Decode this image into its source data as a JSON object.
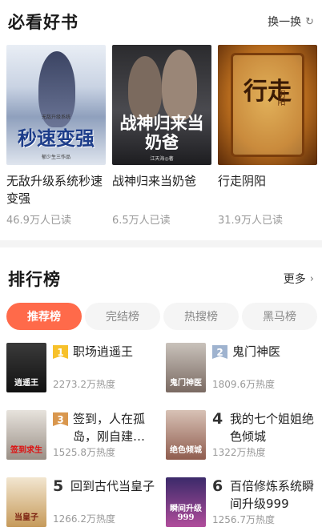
{
  "must_read": {
    "title": "必看好书",
    "refresh_label": "换一换",
    "refresh_icon": "refresh-icon",
    "books": [
      {
        "title": "无敌升级系统秒速变强",
        "reads": "46.9万人已读",
        "cover_text": "秒速变强",
        "cover_small_top": "无敌升级系统",
        "cover_small_bottom": "郁少生三作品"
      },
      {
        "title": "战神归来当奶爸",
        "reads": "6.5万人已读",
        "cover_text": "战神归来当奶爸",
        "cover_small_bottom": "江天海◎著"
      },
      {
        "title": "行走阴阳",
        "reads": "31.9万人已读",
        "cover_text": "行走",
        "cover_small_side": "阴阳"
      }
    ]
  },
  "ranking": {
    "title": "排行榜",
    "more_label": "更多",
    "more_icon": "chevron-right-icon",
    "tabs": [
      "推荐榜",
      "完结榜",
      "热搜榜",
      "黑马榜"
    ],
    "active_tab": "推荐榜",
    "items": [
      {
        "rank": "1",
        "title": "职场逍遥王",
        "heat": "2273.2万热度",
        "cover_text": "逍遥王"
      },
      {
        "rank": "2",
        "title": "鬼门神医",
        "heat": "1809.6万热度",
        "cover_text": "鬼门神医"
      },
      {
        "rank": "3",
        "title": "签到，人在孤岛，刚自建…",
        "heat": "1525.8万热度",
        "cover_text": "签到求生"
      },
      {
        "rank": "4",
        "title": "我的七个姐姐绝色倾城",
        "heat": "1322万热度",
        "cover_text": "绝色倾城"
      },
      {
        "rank": "5",
        "title": "回到古代当皇子",
        "heat": "1266.2万热度",
        "cover_text": "当皇子"
      },
      {
        "rank": "6",
        "title": "百倍修炼系统瞬间升级999",
        "heat": "1256.7万热度",
        "cover_text": "瞬间升级999"
      }
    ]
  },
  "colors": {
    "accent": "#ff6a4a",
    "gold": "#f7c12b",
    "silver": "#9fb3cf",
    "bronze": "#d9974e"
  }
}
